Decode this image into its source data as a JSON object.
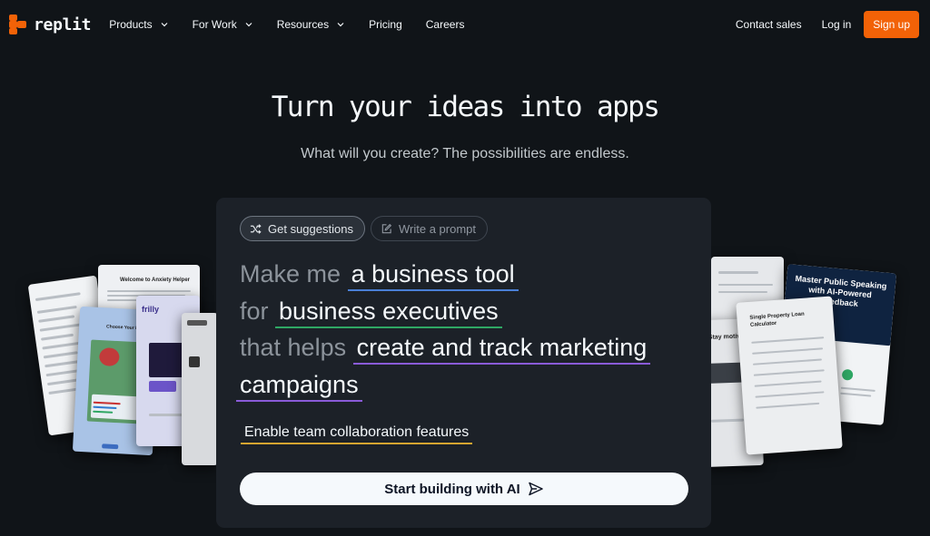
{
  "brand": {
    "name": "replit",
    "accent": "#f26207"
  },
  "nav": {
    "items": [
      {
        "label": "Products",
        "dropdown": true
      },
      {
        "label": "For Work",
        "dropdown": true
      },
      {
        "label": "Resources",
        "dropdown": true
      },
      {
        "label": "Pricing",
        "dropdown": false
      },
      {
        "label": "Careers",
        "dropdown": false
      }
    ],
    "contact_sales": "Contact sales",
    "log_in": "Log in",
    "sign_up": "Sign up"
  },
  "hero": {
    "title": "Turn your ideas into apps",
    "subtitle": "What will you create? The possibilities are endless."
  },
  "prompt_panel": {
    "tabs": [
      {
        "label": "Get suggestions",
        "icon": "shuffle-icon",
        "active": true
      },
      {
        "label": "Write a prompt",
        "icon": "edit-icon",
        "active": false
      }
    ],
    "lines": [
      {
        "prefix": "Make me",
        "pick": "a business tool"
      },
      {
        "prefix": "for",
        "pick": "business executives"
      },
      {
        "prefix": "that helps",
        "pick": "create and track marketing"
      },
      {
        "prefix": "",
        "pick": "campaigns"
      }
    ],
    "feature": "Enable team collaboration features",
    "cta_label": "Start building with AI",
    "cta_icon": "send-icon"
  },
  "previews": {
    "left": [
      {
        "title": "Welcome to Anxiety Helper"
      },
      {
        "title": "frilly"
      },
      {
        "title": "Choose Your Fruit"
      }
    ],
    "right": [
      {
        "title": "Master Public Speaking with AI-Powered Feedback"
      },
      {
        "title": "Single Property Loan Calculator"
      },
      {
        "title": "Stay motivated"
      }
    ]
  }
}
